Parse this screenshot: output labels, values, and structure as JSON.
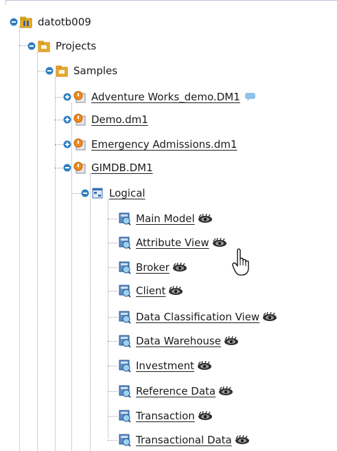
{
  "tree": {
    "root": {
      "label": "datotb009",
      "icon": "database-folder-icon"
    },
    "projects": {
      "label": "Projects",
      "icon": "project-folder-icon"
    },
    "samples": {
      "label": "Samples",
      "icon": "project-folder-icon"
    },
    "models": [
      {
        "label": "Adventure Works_demo.DM1",
        "icon": "model-file-icon",
        "badge": "comment-bubble-icon"
      },
      {
        "label": "Demo.dm1",
        "icon": "model-file-icon"
      },
      {
        "label": "Emergency Admissions.dm1",
        "icon": "model-file-icon"
      },
      {
        "label": "GIMDB.DM1",
        "icon": "model-file-icon"
      }
    ],
    "logical": {
      "label": "Logical",
      "icon": "logical-model-icon"
    },
    "submodels": [
      {
        "label": "Main Model",
        "icon": "submodel-icon",
        "badge": "eye-icon"
      },
      {
        "label": "Attribute View",
        "icon": "submodel-icon",
        "badge": "eye-icon"
      },
      {
        "label": "Broker",
        "icon": "submodel-icon",
        "badge": "eye-icon"
      },
      {
        "label": "Client",
        "icon": "submodel-icon",
        "badge": "eye-icon"
      },
      {
        "label": "Data Classification View",
        "icon": "submodel-icon",
        "badge": "eye-icon"
      },
      {
        "label": "Data Warehouse",
        "icon": "submodel-icon",
        "badge": "eye-icon"
      },
      {
        "label": "Investment",
        "icon": "submodel-icon",
        "badge": "eye-icon"
      },
      {
        "label": "Reference Data",
        "icon": "submodel-icon",
        "badge": "eye-icon"
      },
      {
        "label": "Transaction",
        "icon": "submodel-icon",
        "badge": "eye-icon"
      },
      {
        "label": "Transactional Data",
        "icon": "submodel-icon",
        "badge": "eye-icon"
      }
    ]
  },
  "cursor": "hand-pointer-icon"
}
